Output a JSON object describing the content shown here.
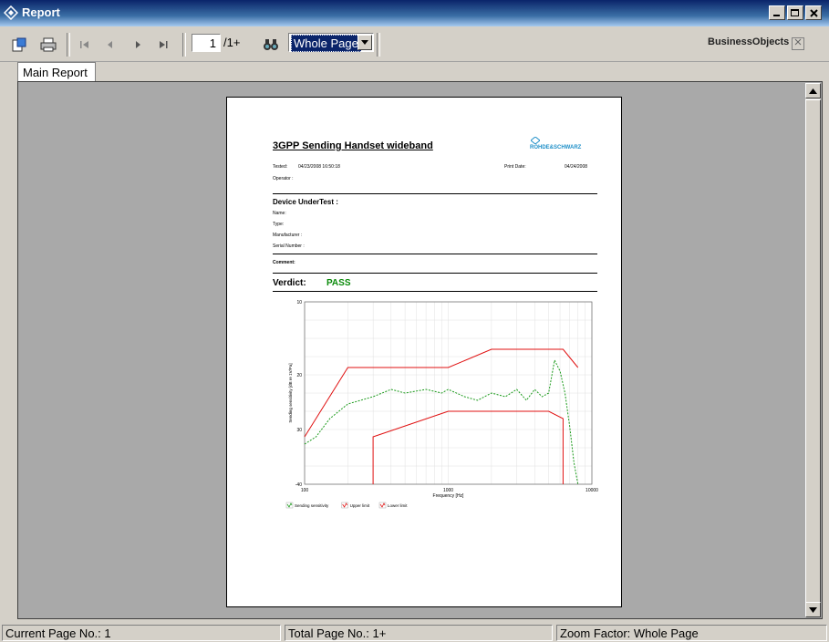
{
  "window": {
    "title": "Report"
  },
  "toolbar": {
    "page_current": "1",
    "page_total": "/1+",
    "zoom_value": "Whole Page",
    "brand": "BusinessObjects"
  },
  "tabs": [
    {
      "label": "Main Report"
    }
  ],
  "report": {
    "title": "3GPP Sending Handset wideband",
    "logo_text": "ROHDE&SCHWARZ",
    "tested_label": "Tested:",
    "tested_value": "04/23/2008  16:50:18",
    "print_date_label": "Print Date:",
    "print_date_value": "04/24/2008",
    "operator_label": "Operator :",
    "dut_heading": "Device UnderTest :",
    "dut_fields": [
      "Name:",
      "Type:",
      "Manufacturer :",
      "Serial Number :"
    ],
    "comment_label": "Comment:",
    "verdict_label": "Verdict:",
    "verdict_value": "PASS"
  },
  "chart_data": {
    "type": "line",
    "xlabel": "Frequency [Hz]",
    "ylabel": "Sending sensitivity [dB re 1V/Pa]",
    "xscale": "log",
    "xlim": [
      100,
      10000
    ],
    "ylim": [
      -40,
      10
    ],
    "xticks": [
      "100",
      "1000",
      "10000"
    ],
    "yticks": [
      "10",
      "20",
      "30",
      "-40"
    ],
    "grid": true,
    "legend_position": "bottom-left",
    "colors": {
      "measured": "#1a9a1a",
      "limit": "#e01010"
    },
    "series": [
      {
        "name": "Sending sensitivity",
        "x": [
          100,
          120,
          150,
          200,
          300,
          400,
          500,
          700,
          900,
          1000,
          1300,
          1600,
          2000,
          2500,
          3000,
          3500,
          4000,
          4500,
          5000,
          5500,
          6000,
          6500,
          7000,
          7500,
          8000
        ],
        "y": [
          -29,
          -27,
          -22,
          -18,
          -16,
          -14,
          -15,
          -14,
          -15,
          -14,
          -16,
          -17,
          -15,
          -16,
          -14,
          -17,
          -14,
          -16,
          -15,
          -6,
          -9,
          -15,
          -24,
          -34,
          -40
        ]
      },
      {
        "name": "Upper limit",
        "x": [
          100,
          200,
          1000,
          2000,
          5000,
          6300,
          8000
        ],
        "y": [
          -27,
          -8,
          -8,
          -3,
          -3,
          -3,
          -8
        ]
      },
      {
        "name": "Lower limit",
        "x": [
          300,
          300,
          1000,
          5000,
          6300,
          6300
        ],
        "y": [
          -40,
          -27,
          -20,
          -20,
          -22,
          -40
        ]
      }
    ]
  },
  "statusbar": {
    "current_page": "Current Page No.: 1",
    "total_page": "Total Page No.: 1+",
    "zoom": "Zoom Factor: Whole Page"
  }
}
